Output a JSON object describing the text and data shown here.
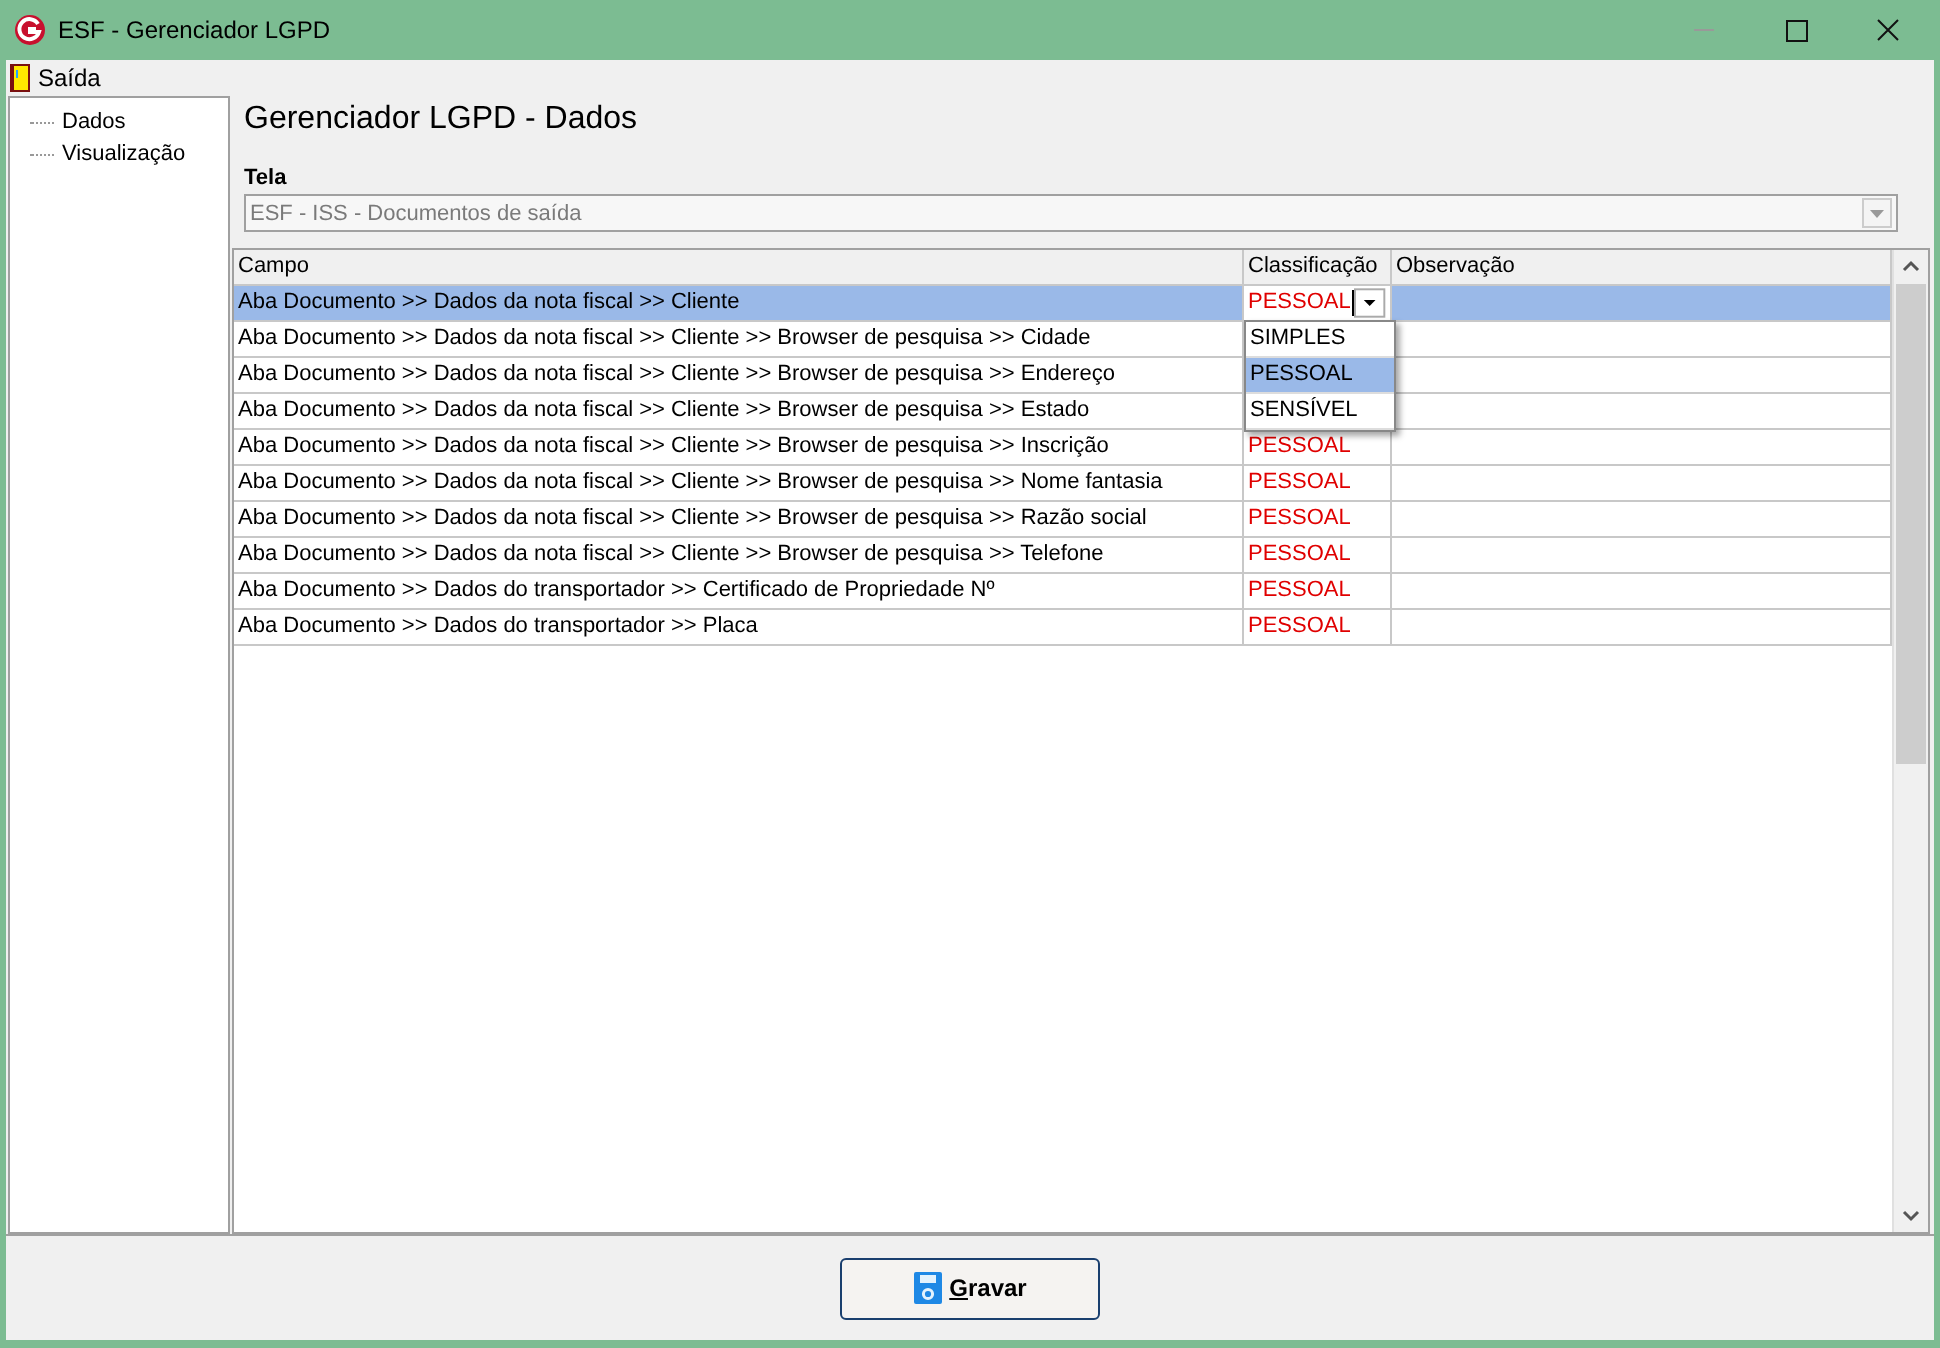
{
  "window": {
    "title": "ESF - Gerenciador LGPD"
  },
  "menu": [
    {
      "label": "Saída"
    }
  ],
  "sidebar": {
    "items": [
      {
        "label": "Dados",
        "selected": false
      },
      {
        "label": "Visualização",
        "selected": false
      }
    ]
  },
  "heading": "Gerenciador LGPD - Dados",
  "tela": {
    "label": "Tela",
    "value": "ESF - ISS - Documentos de saída",
    "disabled": true
  },
  "table": {
    "columns": [
      "Campo",
      "Classificação",
      "Observação"
    ],
    "rows": [
      {
        "campo": "Aba Documento >> Dados da nota fiscal >> Cliente",
        "classificacao": "PESSOAL",
        "selected": true,
        "editing": true
      },
      {
        "campo": "Aba Documento >> Dados da nota fiscal >> Cliente >> Browser de pesquisa >> Cidade",
        "selected": false,
        "editing": false
      },
      {
        "campo": "Aba Documento >> Dados da nota fiscal >> Cliente >> Browser de pesquisa >> Endereço",
        "selected": false,
        "editing": false
      },
      {
        "campo": "Aba Documento >> Dados da nota fiscal >> Cliente >> Browser de pesquisa >> Estado",
        "selected": false,
        "editing": false
      },
      {
        "campo": "Aba Documento >> Dados da nota fiscal >> Cliente >> Browser de pesquisa >> Inscrição",
        "classificacao": "PESSOAL",
        "selected": false,
        "editing": false
      },
      {
        "campo": "Aba Documento >> Dados da nota fiscal >> Cliente >> Browser de pesquisa >> Nome fantasia",
        "classificacao": "PESSOAL",
        "selected": false,
        "editing": false
      },
      {
        "campo": "Aba Documento >> Dados da nota fiscal >> Cliente >> Browser de pesquisa >> Razão social",
        "classificacao": "PESSOAL",
        "selected": false,
        "editing": false
      },
      {
        "campo": "Aba Documento >> Dados da nota fiscal >> Cliente >> Browser de pesquisa >> Telefone",
        "classificacao": "PESSOAL",
        "selected": false,
        "editing": false
      },
      {
        "campo": "Aba Documento >> Dados do transportador >> Certificado de Propriedade Nº",
        "classificacao": "PESSOAL",
        "selected": false,
        "editing": false
      },
      {
        "campo": "Aba Documento >> Dados do transportador >> Placa",
        "classificacao": "PESSOAL",
        "selected": false,
        "editing": false
      }
    ]
  },
  "dropdown": {
    "options": [
      {
        "label": "SIMPLES",
        "selected": false
      },
      {
        "label": "PESSOAL",
        "selected": true
      },
      {
        "label": "SENSÍVEL",
        "selected": false
      }
    ]
  },
  "save_button": {
    "label": "Gravar"
  }
}
